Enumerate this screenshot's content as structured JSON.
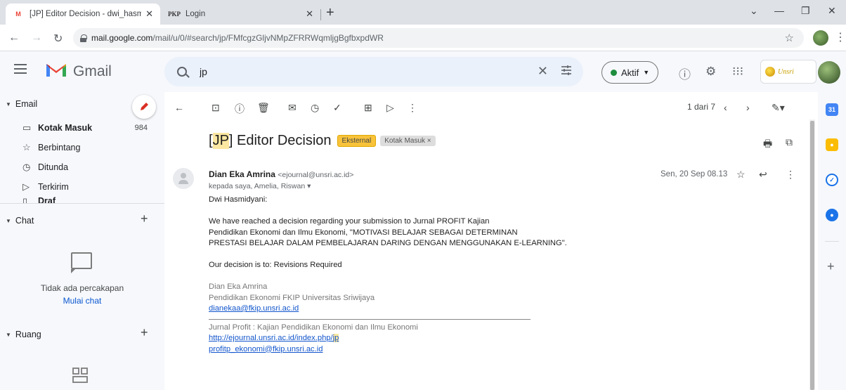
{
  "browser": {
    "tabs": [
      {
        "favicon": "M",
        "title": "[JP] Editor Decision - dwi_hasmid"
      },
      {
        "favicon": "PKP",
        "title": "Login"
      }
    ],
    "url_host": "mail.google.com",
    "url_path": "/mail/u/0/#search/jp/FMfcgzGljvNMpZFRRWqmljgBgfbxpdWR"
  },
  "header": {
    "app_name": "Gmail",
    "search_value": "jp",
    "status_label": "Aktif",
    "unsri_text": "Unsri"
  },
  "sidebar": {
    "email_section": "Email",
    "items": [
      {
        "label": "Kotak Masuk",
        "count": "984",
        "icon": "inbox-icon"
      },
      {
        "label": "Berbintang",
        "count": "",
        "icon": "star-icon"
      },
      {
        "label": "Ditunda",
        "count": "",
        "icon": "clock-icon"
      },
      {
        "label": "Terkirim",
        "count": "",
        "icon": "send-icon"
      },
      {
        "label": "Draf",
        "count": "",
        "icon": "draft-icon"
      }
    ],
    "chat_section": "Chat",
    "chat_empty": "Tidak ada percakapan",
    "chat_start": "Mulai chat",
    "rooms_section": "Ruang"
  },
  "toolbar": {
    "pager": "1 dari 7"
  },
  "message": {
    "subject_prefix": "[",
    "subject_hl": "JP",
    "subject_rest": "] Editor Decision",
    "badge_external": "Eksternal",
    "badge_inbox": "Kotak Masuk ×",
    "sender_name": "Dian Eka Amrina",
    "sender_email": "<ejournal@unsri.ac.id>",
    "recipients": "kepada saya, Amelia, Riswan ▾",
    "date": "Sen, 20 Sep 08.13",
    "greeting": "Dwi Hasmidyani:",
    "para1_l1": "We have reached a decision regarding your submission to Jurnal PROFIT Kajian",
    "para1_l2": "Pendidikan Ekonomi dan Ilmu Ekonomi, \"MOTIVASI BELAJAR SEBAGAI DETERMINAN",
    "para1_l3": "PRESTASI BELAJAR  DALAM PEMBELAJARAN DARING DENGAN MENGGUNAKAN E-LEARNING\".",
    "decision": "Our decision is to: Revisions Required",
    "sig_name": "Dian Eka Amrina",
    "sig_affil": "Pendidikan Ekonomi FKIP Universitas Sriwijaya",
    "sig_email": "dianekaa@fkip.unsri.ac.id",
    "journal_name": "Jurnal Profit : Kajian Pendidikan Ekonomi dan Ilmu Ekonomi",
    "journal_url_base": "http://ejournal.unsri.ac.id/index.php/",
    "journal_url_hl": "jp",
    "journal_email": "profitp_ekonomi@fkip.unsri.ac.id"
  },
  "colors": {
    "accent": "#0b57d0",
    "badge_external": "#f8c33a",
    "status_green": "#1e8e3e"
  }
}
